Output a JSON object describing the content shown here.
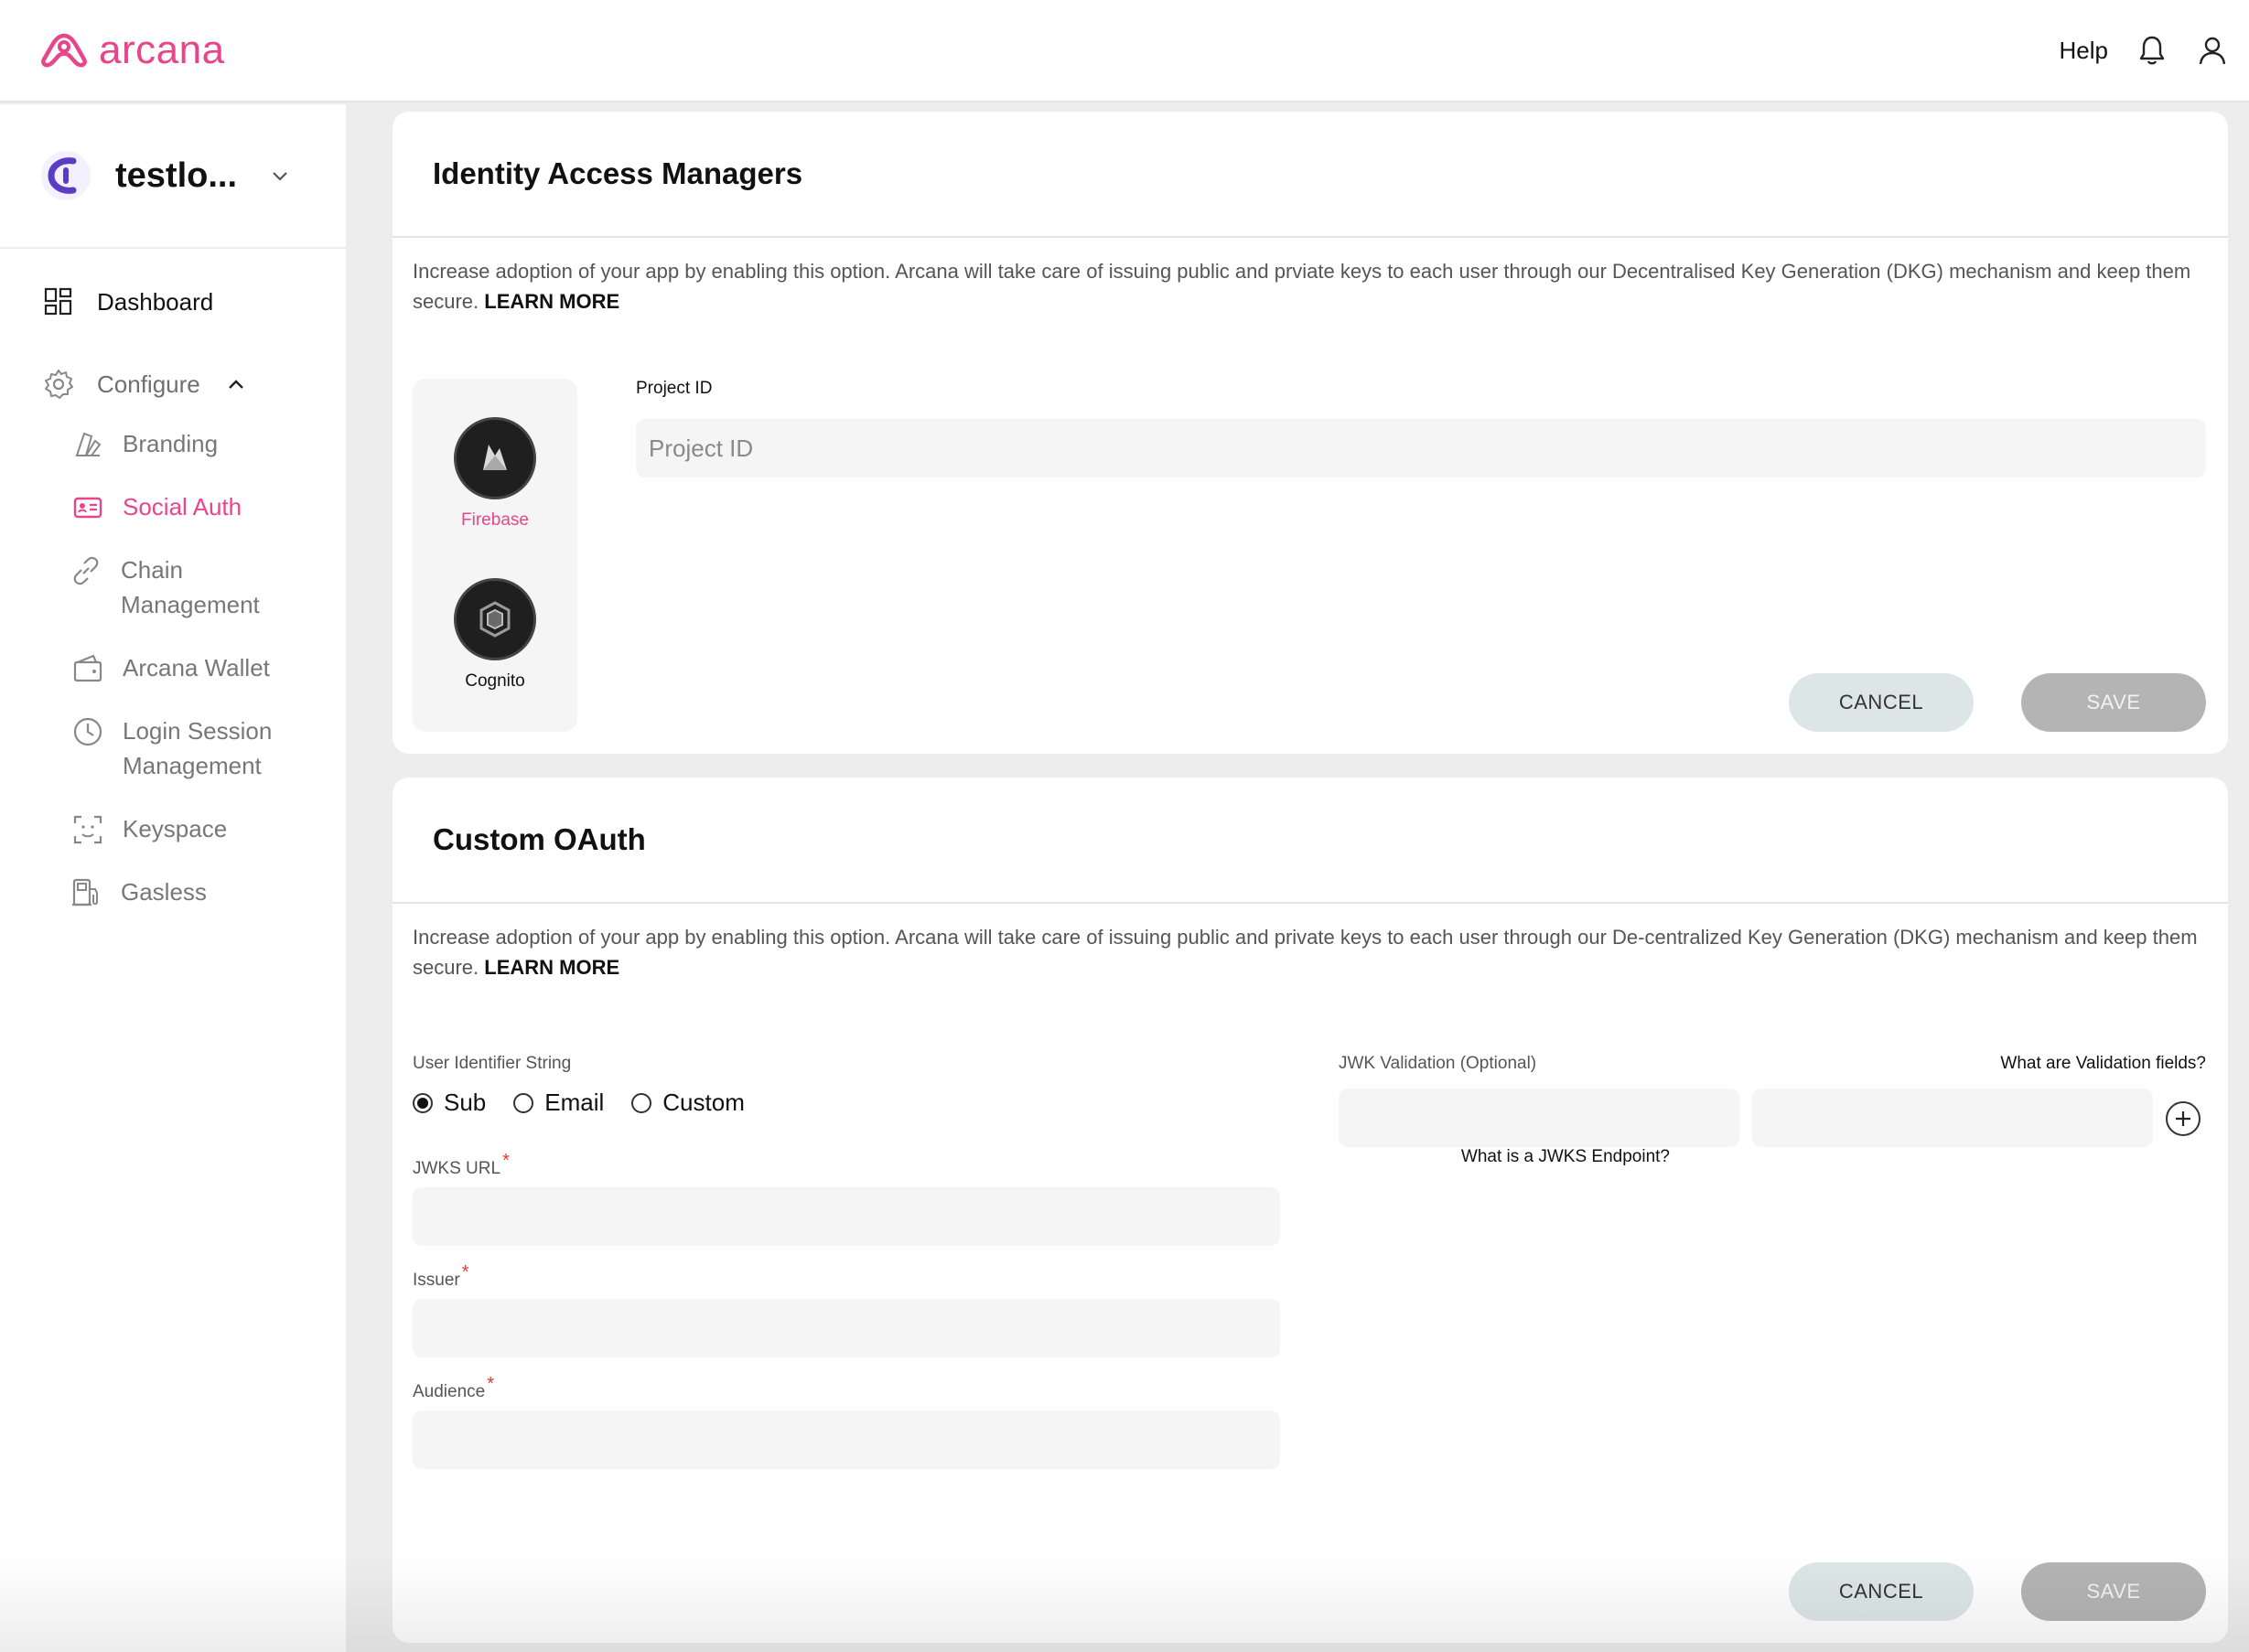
{
  "app": {
    "brand_name": "arcana",
    "brand_color": "#e8458b"
  },
  "header": {
    "help_label": "Help",
    "icons": [
      "bell-icon",
      "user-icon"
    ]
  },
  "sidebar": {
    "org_name": "testlo...",
    "nav": {
      "dashboard_label": "Dashboard",
      "configure_label": "Configure"
    },
    "sub_items": [
      {
        "label": "Branding",
        "icon": "branding-icon"
      },
      {
        "label": "Social Auth",
        "icon": "social-auth-icon",
        "active": true
      },
      {
        "label": "Chain Management",
        "icon": "link-icon"
      },
      {
        "label": "Arcana Wallet",
        "icon": "wallet-icon"
      },
      {
        "label": "Login Session Management",
        "icon": "clock-icon"
      },
      {
        "label": "Keyspace",
        "icon": "face-scan-icon"
      },
      {
        "label": "Gasless",
        "icon": "fuel-icon"
      }
    ]
  },
  "iam": {
    "title": "Identity Access Managers",
    "description": "Increase adoption of your app by enabling this option. Arcana will take care of issuing public and prviate keys to each user through our Decentralised Key Generation (DKG) mechanism and keep them secure.",
    "learn_more": "LEARN MORE",
    "providers": [
      {
        "label": "Firebase",
        "icon": "firebase-icon",
        "active": true
      },
      {
        "label": "Cognito",
        "icon": "cognito-icon",
        "active": false
      }
    ],
    "project_id_label": "Project ID",
    "project_id_placeholder": "Project ID",
    "project_id_value": "",
    "cancel_label": "CANCEL",
    "save_label": "SAVE"
  },
  "oauth": {
    "title": "Custom OAuth",
    "description": "Increase adoption of your app by enabling this option. Arcana will take care of issuing public and private keys to each user through our De-centralized Key Generation (DKG) mechanism and keep them secure.",
    "learn_more": "LEARN MORE",
    "user_identifier_label": "User Identifier String",
    "radio_options": [
      {
        "label": "Sub",
        "selected": true
      },
      {
        "label": "Email",
        "selected": false
      },
      {
        "label": "Custom",
        "selected": false
      }
    ],
    "jwks_url_label": "JWKS URL",
    "jwks_help": "What is a JWKS Endpoint?",
    "issuer_label": "Issuer",
    "audience_label": "Audience",
    "required_mark": "*",
    "jwk_validation_label": "JWK Validation (Optional)",
    "validation_help": "What are Validation fields?",
    "jwks_url_value": "",
    "issuer_value": "",
    "audience_value": "",
    "jwk_key_value": "",
    "jwk_value_value": "",
    "cancel_label": "CANCEL",
    "save_label": "SAVE"
  }
}
